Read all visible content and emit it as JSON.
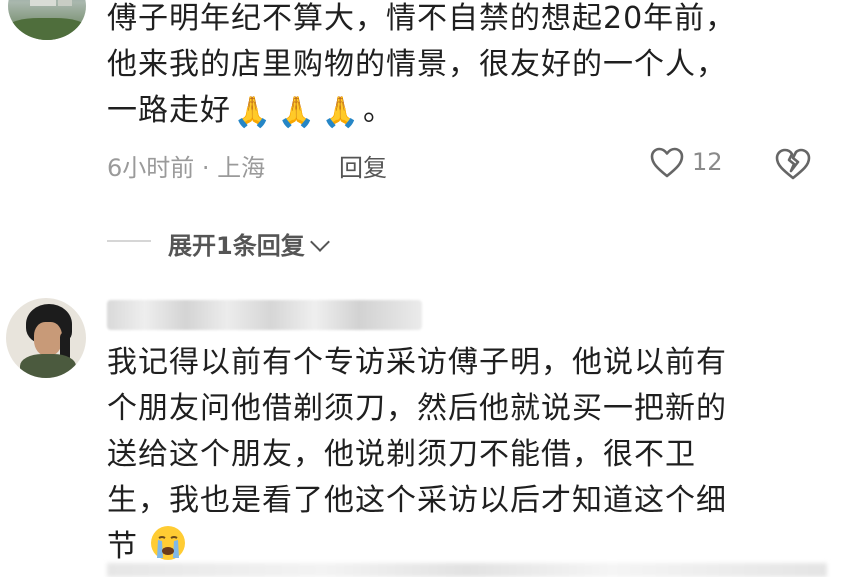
{
  "comments": [
    {
      "text_lines": [
        "傅子明年纪不算大，情不自禁的想起20年前，",
        "他来我的店里购物的情景，很友好的一个人，",
        "一路走好"
      ],
      "text_end": "。",
      "emoji_trail": [
        "🙏",
        "🙏",
        "🙏"
      ],
      "meta": "6小时前 · 上海",
      "reply_label": "回复",
      "like_count": "12",
      "expand_label": "展开1条回复"
    },
    {
      "text_lines": [
        "我记得以前有个专访采访傅子明，他说以前有",
        "个朋友问他借剃须刀，然后他就说买一把新的",
        "送给这个朋友，他说剃须刀不能借，很不卫",
        "生，我也是看了他这个采访以后才知道这个细",
        "节"
      ]
    }
  ],
  "colors": {
    "text": "#1f1f1f",
    "meta": "#9a9a9a",
    "emoji_pray": "#f4b400",
    "emoji_sad": "#7fb8e8"
  },
  "icons": [
    "heart-icon",
    "broken-heart-icon",
    "chevron-down-icon",
    "praying-hands-emoji",
    "crying-face-emoji"
  ]
}
